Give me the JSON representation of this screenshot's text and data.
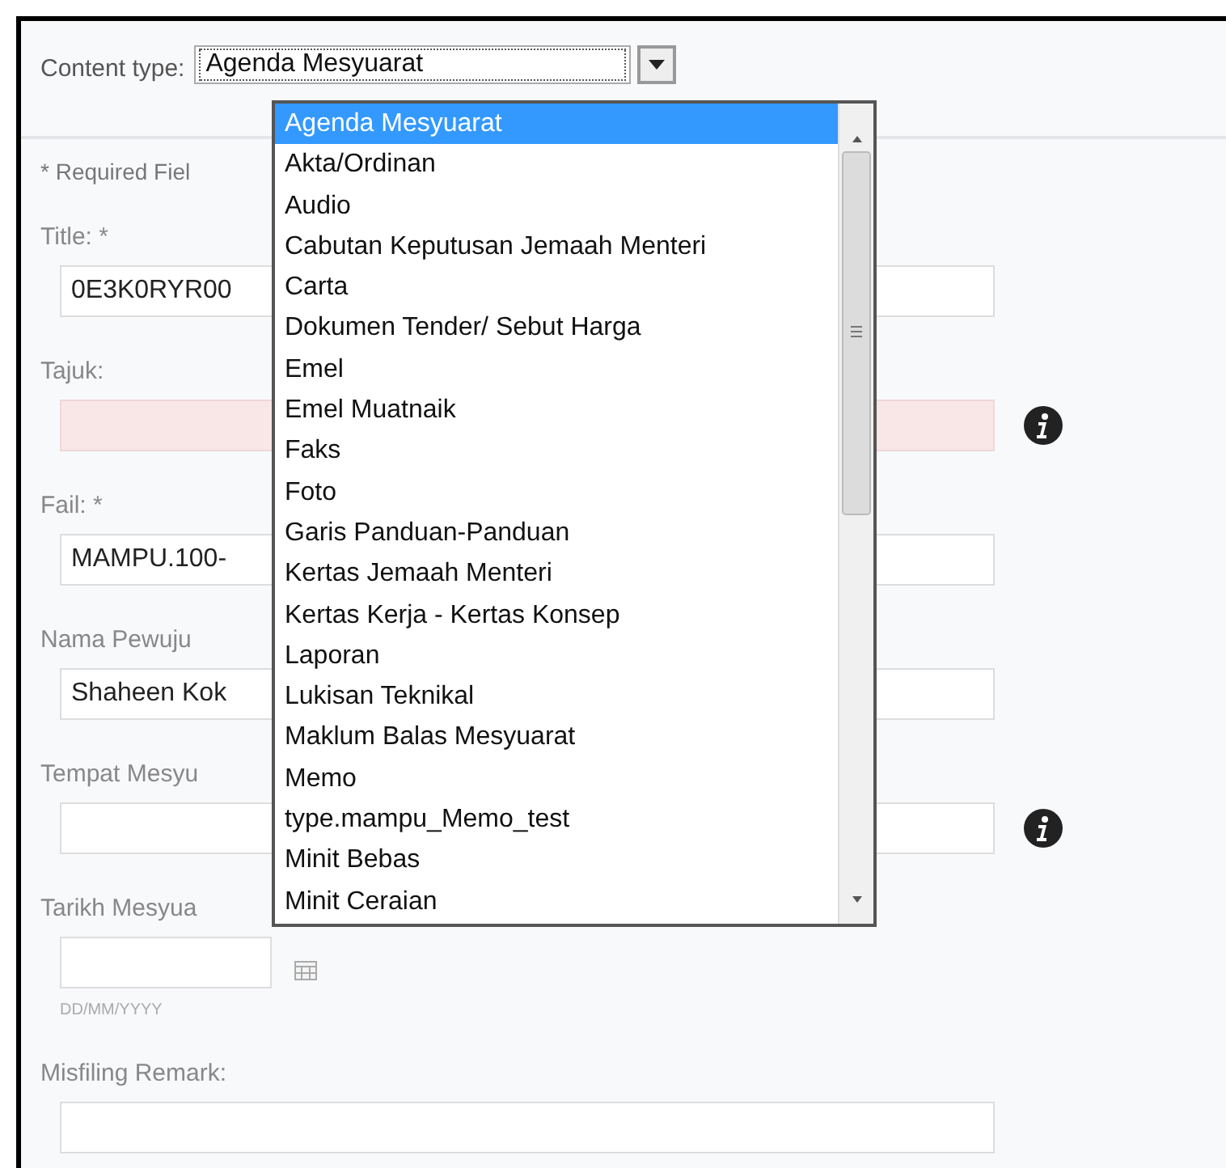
{
  "content_type": {
    "label": "Content type:",
    "value": "Agenda Mesyuarat"
  },
  "dropdown": {
    "options": [
      {
        "label": "Agenda Mesyuarat",
        "selected": true
      },
      {
        "label": "Akta/Ordinan",
        "selected": false
      },
      {
        "label": "Audio",
        "selected": false
      },
      {
        "label": "Cabutan Keputusan Jemaah Menteri",
        "selected": false
      },
      {
        "label": "Carta",
        "selected": false
      },
      {
        "label": "Dokumen Tender/ Sebut Harga",
        "selected": false
      },
      {
        "label": "Emel",
        "selected": false
      },
      {
        "label": "Emel Muatnaik",
        "selected": false
      },
      {
        "label": "Faks",
        "selected": false
      },
      {
        "label": "Foto",
        "selected": false
      },
      {
        "label": "Garis Panduan-Panduan",
        "selected": false
      },
      {
        "label": "Kertas Jemaah Menteri",
        "selected": false
      },
      {
        "label": "Kertas Kerja - Kertas Konsep",
        "selected": false
      },
      {
        "label": "Laporan",
        "selected": false
      },
      {
        "label": "Lukisan Teknikal",
        "selected": false
      },
      {
        "label": "Maklum Balas Mesyuarat",
        "selected": false
      },
      {
        "label": "Memo",
        "selected": false
      },
      {
        "label": "type.mampu_Memo_test",
        "selected": false
      },
      {
        "label": "Minit Bebas",
        "selected": false
      },
      {
        "label": "Minit Ceraian",
        "selected": false
      }
    ]
  },
  "required_note": "* Required Fiel",
  "fields": [
    {
      "kind": "text",
      "label": "Title: *",
      "value": "0E3K0RYR00",
      "invalid": false,
      "info": false
    },
    {
      "kind": "text",
      "label": "Tajuk:",
      "invalid": true,
      "info": true
    },
    {
      "kind": "text",
      "label": "Fail: *",
      "value": "MAMPU.100-",
      "invalid": false,
      "info": false
    },
    {
      "kind": "text",
      "label": "Nama Pewuju",
      "value": "Shaheen Kok",
      "invalid": false,
      "info": false
    },
    {
      "kind": "text",
      "label": "Tempat Mesyu",
      "invalid": false,
      "info": true
    },
    {
      "kind": "date",
      "label": "Tarikh Mesyua",
      "hint": "DD/MM/YYYY",
      "invalid": false,
      "info": false
    },
    {
      "kind": "text",
      "label": "Misfiling Remark:",
      "invalid": false,
      "info": false
    }
  ]
}
